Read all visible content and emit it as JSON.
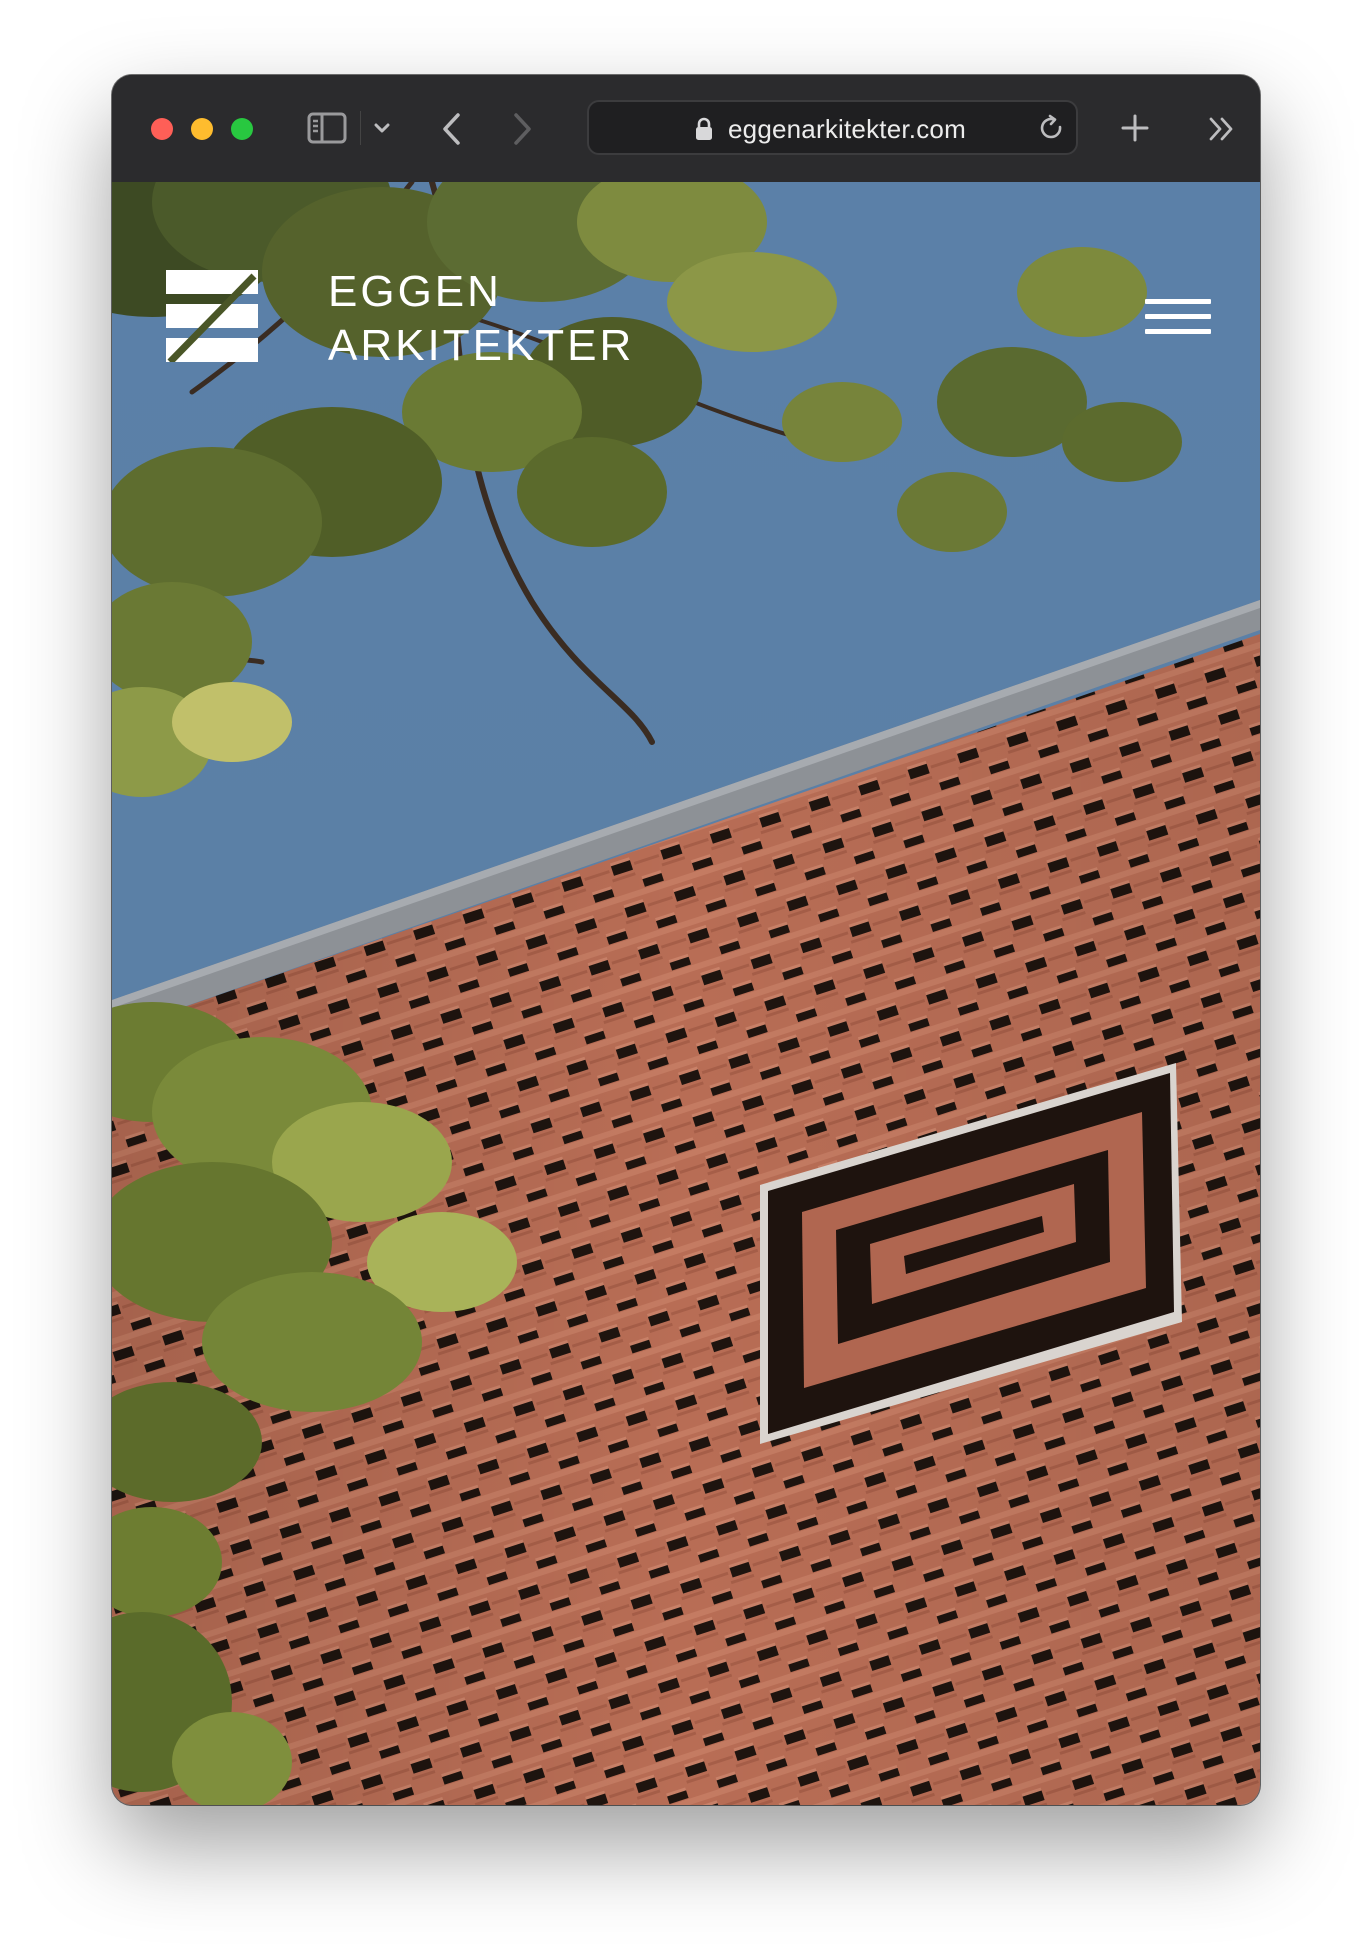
{
  "browser": {
    "url": "eggenarkitekter.com",
    "icons": {
      "close": "close-light",
      "minimize": "minimize-light",
      "zoom": "zoom-light",
      "sidebar": "sidebar-icon",
      "sidebar_menu": "chevron-down-icon",
      "back": "back-chevron-icon",
      "forward": "forward-chevron-icon",
      "lock": "lock-icon",
      "reload": "reload-icon",
      "new_tab": "plus-icon",
      "more": "double-chevron-icon"
    },
    "colors": {
      "close": "#fe5f57",
      "minimize": "#febc2e",
      "zoom": "#28c840"
    }
  },
  "site": {
    "logo_line1": "EGGEN",
    "logo_line2": "ARKITEKTER",
    "menu_icon": "hamburger-menu-icon"
  }
}
